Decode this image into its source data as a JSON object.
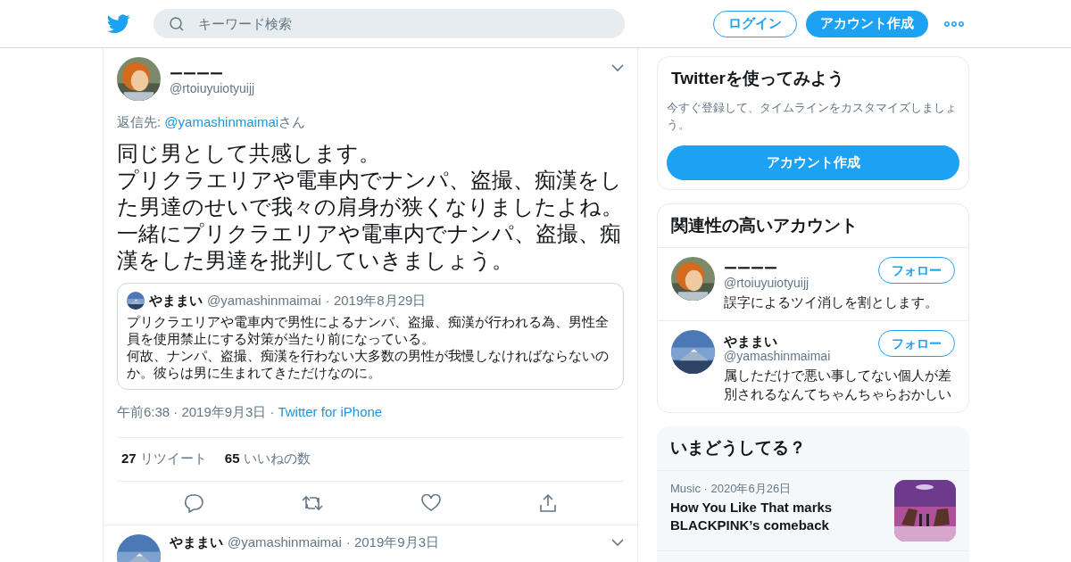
{
  "header": {
    "search": {
      "placeholder": "キーワード検索"
    },
    "login": "ログイン",
    "signup": "アカウント作成"
  },
  "tweet": {
    "name": "ーーーー",
    "handle": "@rtoiuyuiotyuijj",
    "reply_label": "返信先: ",
    "reply_to": "@yamashinmaimai",
    "reply_suffix": "さん",
    "text": [
      "同じ男として共感します。",
      "プリクラエリアや電車内でナンパ、盗撮、痴漢をした男達のせいで我々の肩身が狭くなりましたよね。",
      "一緒にプリクラエリアや電車内でナンパ、盗撮、痴漢をした男達を批判していきましょう。"
    ],
    "separator": "·",
    "quote": {
      "name": "やままい",
      "handle": "@yamashinmaimai",
      "separator": "·",
      "date": "2019年8月29日",
      "text": [
        "プリクラエリアや電車内で男性によるナンパ、盗撮、痴漢が行われる為、男性全員を使用禁止にする対策が当たり前になっている。",
        "何故、ナンパ、盗撮、痴漢を行わない大多数の男性が我慢しなければならないのか。彼らは男に生まれてきただけなのに。"
      ]
    },
    "time": "午前6:38",
    "date": "2019年9月3日",
    "source": "Twitter for iPhone",
    "stats": [
      {
        "count": "27",
        "label": "リツイート"
      },
      {
        "count": "65",
        "label": "いいねの数"
      }
    ]
  },
  "next_tweet": {
    "name": "やままい",
    "handle": "@yamashinmaimai",
    "separator": "·",
    "date": "2019年9月3日"
  },
  "signup_card": {
    "title": "Twitterを使ってみよう",
    "text": "今すぐ登録して、タイムラインをカスタマイズしましょう。",
    "button": "アカウント作成"
  },
  "related": {
    "title": "関連性の高いアカウント",
    "accounts": [
      {
        "name": "ーーーー",
        "handle": "@rtoiuyuiotyuijj",
        "bio": "誤字によるツイ消しを割とします。",
        "button": "フォロー"
      },
      {
        "name": "やままい",
        "handle": "@yamashinmaimai",
        "bio": "属しただけで悪い事してない個人が差別されるなんてちゃんちゃらおかしい",
        "button": "フォロー"
      }
    ]
  },
  "trends": {
    "title": "いまどうしてる？",
    "items": [
      {
        "category": "Music",
        "separator": "·",
        "date": "2020年6月26日",
        "headline": "How You Like That marks BLACKPINK’s comeback",
        "kind": "picture"
      }
    ]
  }
}
